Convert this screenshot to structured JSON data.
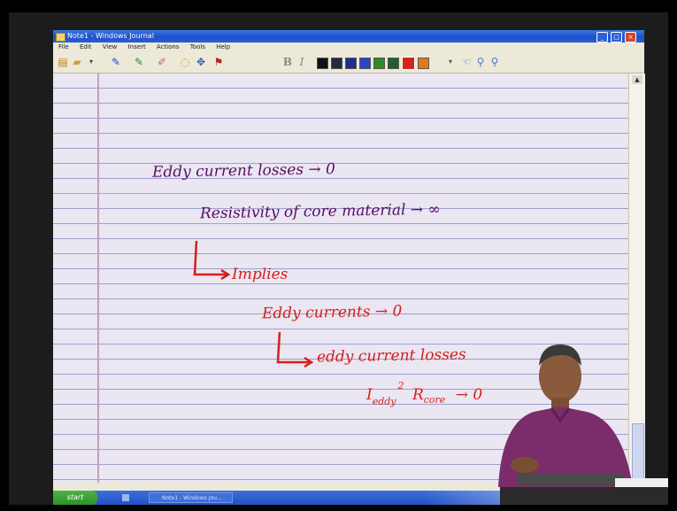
{
  "window": {
    "title": "Note1 - Windows Journal",
    "menu": [
      "File",
      "Edit",
      "View",
      "Insert",
      "Actions",
      "Tools",
      "Help"
    ]
  },
  "toolbar": {
    "bold_label": "B",
    "italic_label": "I",
    "pen_colors": [
      "#111111",
      "#222a44",
      "#1d2f8a",
      "#2846c8",
      "#2f8a2a",
      "#1f5f2a",
      "#d1281c",
      "#e07a18"
    ]
  },
  "notes": {
    "line1": "Eddy current losses → 0",
    "line2": "Resistivity of core material → ∞",
    "line3": "Implies",
    "line4": "Eddy currents → 0",
    "line5": "eddy current losses",
    "line6_main": "I",
    "line6_sub": "eddy",
    "line6_sup": "2",
    "line6_rest": "R",
    "line6_rsub": "core",
    "line6_tail": "→ 0"
  },
  "taskbar": {
    "start_label": "start",
    "task_item": "Note1 - Windows Jou..."
  }
}
